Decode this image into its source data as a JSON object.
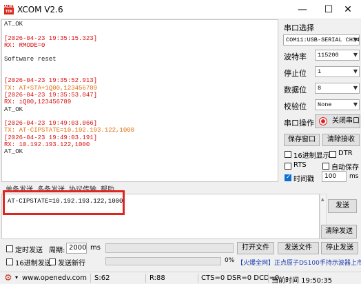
{
  "window": {
    "app_icon_text": "ALIEN TEK",
    "title": "XCOM V2.6",
    "minimize": "—",
    "maximize": "☐",
    "close": "✕"
  },
  "receive_log": [
    {
      "text": "AT_OK",
      "kind": "plain"
    },
    {
      "text": "",
      "kind": "plain"
    },
    {
      "text": "[2026-04-23 19:35:15.323]",
      "kind": "stamp"
    },
    {
      "text": "RX: RMODE=0",
      "kind": "rx"
    },
    {
      "text": "",
      "kind": "plain"
    },
    {
      "text": "Software reset",
      "kind": "plain"
    },
    {
      "text": "",
      "kind": "plain"
    },
    {
      "text": "",
      "kind": "plain"
    },
    {
      "text": "[2026-04-23 19:35:52.913]",
      "kind": "stamp"
    },
    {
      "text": "TX: AT+STA+1Q00,123456789",
      "kind": "tx"
    },
    {
      "text": "[2026-04-23 19:35:53.047]",
      "kind": "stamp"
    },
    {
      "text": "RX: iQ00,123456789",
      "kind": "rx"
    },
    {
      "text": "AT_OK",
      "kind": "plain"
    },
    {
      "text": "",
      "kind": "plain"
    },
    {
      "text": "[2026-04-23 19:49:03.066]",
      "kind": "stamp"
    },
    {
      "text": "TX: AT-CIPSTATE=10.192.193.122,1000",
      "kind": "tx"
    },
    {
      "text": "[2026-04-23 19:49:03.191]",
      "kind": "stamp"
    },
    {
      "text": "RX: 10.192.193.122,1000",
      "kind": "rx"
    },
    {
      "text": "AT_OK",
      "kind": "plain"
    }
  ],
  "side": {
    "port_select_label": "串口选择",
    "port_value": "COM11:USB-SERIAL CH34",
    "baud_label": "波特率",
    "baud_value": "115200",
    "stopbits_label": "停止位",
    "stopbits_value": "1",
    "databits_label": "数据位",
    "databits_value": "8",
    "parity_label": "校验位",
    "parity_value": "None",
    "port_op_label": "串口操作",
    "close_port_button": "关闭串口",
    "save_window_button": "保存窗口",
    "clear_receive_button": "清除接收",
    "hex_display_label": "16进制显示",
    "dtr_label": "DTR",
    "rts_label": "RTS",
    "auto_save_label": "自动保存",
    "timestamp_label": "时间戳",
    "timestamp_value": "100",
    "timestamp_unit": "ms"
  },
  "tabs": [
    "单条发送",
    "多条发送",
    "协议传输",
    "帮助"
  ],
  "send": {
    "text": "AT-CIPSTATE=10.192.193.122,1000",
    "send_button": "发送",
    "clear_send_button": "清除发送"
  },
  "bottom": {
    "timed_send_label": "定时发送",
    "period_label": "周期:",
    "period_value": "2000",
    "period_unit": "ms",
    "open_file_button": "打开文件",
    "send_file_button": "发送文件",
    "stop_send_button": "停止发送",
    "hex_send_label": "16进制发送",
    "send_newline_label": "发送新行",
    "progress_percent": "0%",
    "promo_text": "【火爆全网】正点原子DS100手持示波器上市"
  },
  "status": {
    "gear_icon": "⚙",
    "url": "www.openedv.com",
    "s_count": "S:62",
    "r_count": "R:88",
    "signals": "CTS=0 DSR=0 DCD=0",
    "time": "当前时间 19:50:35"
  },
  "colors": {
    "stamp": "#d81010",
    "tx": "#e36d0b",
    "highlight": "#e0241f",
    "promo": "#1a3db0"
  }
}
